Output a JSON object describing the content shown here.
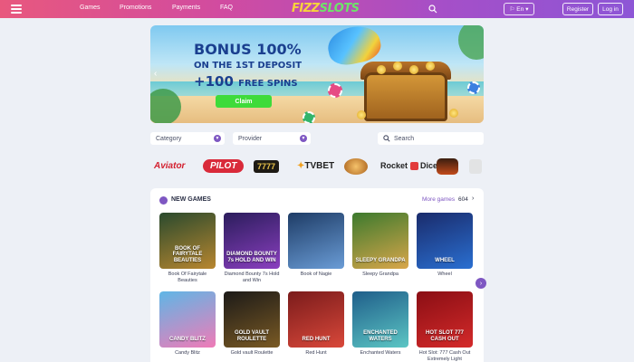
{
  "header": {
    "nav": [
      "Games",
      "Promotions",
      "Payments",
      "FAQ"
    ],
    "logo_part1": "FIZZ",
    "logo_part2": "SLOTS",
    "language": "En",
    "register_label": "Register",
    "login_label": "Log in"
  },
  "banner": {
    "line1": "BONUS 100%",
    "line2": "ON THE 1ST DEPOSIT",
    "line3_amount": "+100",
    "line3_text": "FREE SPINS",
    "claim_label": "Claim"
  },
  "filters": {
    "category_label": "Category",
    "provider_label": "Provider",
    "search_placeholder": "Search"
  },
  "providers": [
    "Aviator",
    "PILOT",
    "7777",
    "TVBET",
    "",
    "Rocket",
    "Dice",
    "",
    ""
  ],
  "games_section": {
    "title": "NEW GAMES",
    "more_label": "More games",
    "count": "604"
  },
  "games": [
    {
      "name": "Book Of Fairytale Beauties",
      "thumb_text": "BOOK OF FAIRYTALE BEAUTIES",
      "colors": [
        "#2a4a2e",
        "#b8862f"
      ]
    },
    {
      "name": "Diamond Bounty 7s Hold and Win",
      "thumb_text": "DIAMOND BOUNTY 7s HOLD AND WIN",
      "colors": [
        "#2b1d5c",
        "#8a3fbf"
      ]
    },
    {
      "name": "Book of Nagie",
      "thumb_text": "",
      "colors": [
        "#1e3c66",
        "#6a9cd6"
      ]
    },
    {
      "name": "Sleepy Grandpa",
      "thumb_text": "SLEEPY GRANDPA",
      "colors": [
        "#3c7a2e",
        "#d9a64a"
      ]
    },
    {
      "name": "Wheel",
      "thumb_text": "WHEEL",
      "colors": [
        "#1a2b6b",
        "#2a6fd1"
      ]
    },
    {
      "name": "Candy Blitz",
      "thumb_text": "CANDY BLITZ",
      "colors": [
        "#5fb6e6",
        "#f07bb7"
      ]
    },
    {
      "name": "Gold vault Roulette",
      "thumb_text": "GOLD VAULT ROULETTE",
      "colors": [
        "#1c1a18",
        "#7a5a24"
      ]
    },
    {
      "name": "Red Hunt",
      "thumb_text": "RED HUNT",
      "colors": [
        "#7a1b1b",
        "#d9483a"
      ]
    },
    {
      "name": "Enchanted Waters",
      "thumb_text": "ENCHANTED WATERS",
      "colors": [
        "#1f5e8a",
        "#5cc6c4"
      ]
    },
    {
      "name": "Hot Slot: 777 Cash Out Extremely Light",
      "thumb_text": "HOT SLOT 777 CASH OUT",
      "colors": [
        "#8a0e14",
        "#d42a2a"
      ]
    }
  ],
  "colors": {
    "accent": "#7e57c2",
    "claim_button": "#3edb3a",
    "background": "#edf0f6"
  }
}
